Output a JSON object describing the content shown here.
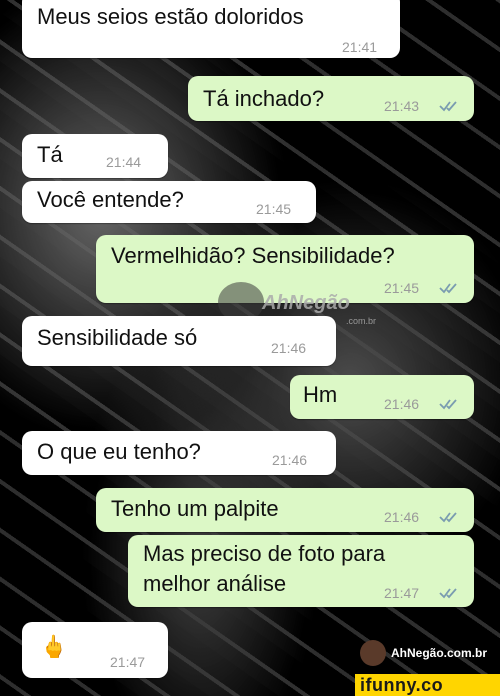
{
  "messages": [
    {
      "text": "Meus seios estão doloridos",
      "time": "21:41",
      "dir": "in"
    },
    {
      "text": "Tá inchado?",
      "time": "21:43",
      "dir": "out"
    },
    {
      "text": "Tá",
      "time": "21:44",
      "dir": "in"
    },
    {
      "text": "Você entende?",
      "time": "21:45",
      "dir": "in"
    },
    {
      "text": "Vermelhidão? Sensibilidade?",
      "time": "21:45",
      "dir": "out"
    },
    {
      "text": "Sensibilidade só",
      "time": "21:46",
      "dir": "in"
    },
    {
      "text": "Hm",
      "time": "21:46",
      "dir": "out"
    },
    {
      "text": "O que eu tenho?",
      "time": "21:46",
      "dir": "in"
    },
    {
      "text": "Tenho um palpite",
      "time": "21:46",
      "dir": "out"
    },
    {
      "text_line1": "Mas preciso de foto para",
      "text_line2": "melhor análise",
      "time": "21:47",
      "dir": "out"
    },
    {
      "emoji": "🖕",
      "time": "21:47",
      "dir": "in"
    }
  ],
  "watermarks": {
    "center_brand": "AhNegão",
    "center_domain": ".com.br",
    "bottom_site": "AhNegão.com.br",
    "ifunny": "ifunny.co"
  },
  "colors": {
    "incoming": "#ffffff",
    "outgoing": "#dcf8c6",
    "tick": "#7a9cb0",
    "ifunny": "#ffd500"
  }
}
